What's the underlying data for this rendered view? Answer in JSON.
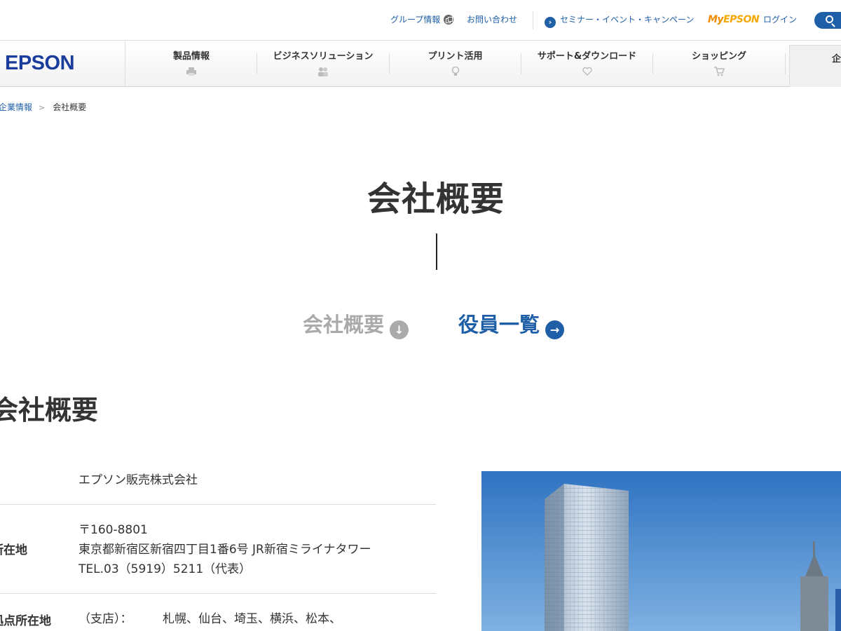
{
  "topbar": {
    "group_info": "グループ情報",
    "contact": "お問い合わせ",
    "seminar": "セミナー・イベント・キャンペーン",
    "myepson_my": "My",
    "myepson_ep": "EPSON",
    "login": "ログイン"
  },
  "nav": {
    "logo": "EPSON",
    "items": [
      {
        "label": "製品情報",
        "icon": "printer-icon"
      },
      {
        "label": "ビジネスソリューション",
        "icon": "people-icon"
      },
      {
        "label": "プリント活用",
        "icon": "lightbulb-icon"
      },
      {
        "label": "サポート&ダウンロード",
        "icon": "heart-icon"
      },
      {
        "label": "ショッピング",
        "icon": "cart-icon"
      }
    ],
    "active_label": "企業情報"
  },
  "breadcrumb": {
    "parent": "企業情報",
    "separator": ">",
    "current": "会社概要"
  },
  "hero": {
    "title": "会社概要",
    "anchor_current": "会社概要",
    "anchor_next": "役員一覧"
  },
  "section": {
    "title": "会社概要",
    "rows": [
      {
        "label": "",
        "lines": [
          "エプソン販売株式会社"
        ]
      },
      {
        "label": "所在地",
        "lines": [
          "〒160-8801",
          "東京都新宿区新宿四丁目1番6号 JR新宿ミライナタワー",
          "TEL.03（5919）5211（代表）"
        ]
      },
      {
        "label": "拠点所在地",
        "sub": "（支店）：",
        "lines": [
          "札幌、仙台、埼玉、横浜、松本、"
        ]
      }
    ]
  },
  "colors": {
    "brand_blue": "#1f5fa8",
    "logo_blue": "#1a3c9c",
    "myepson_orange": "#f08c00",
    "muted_gray": "#aaaaaa"
  }
}
